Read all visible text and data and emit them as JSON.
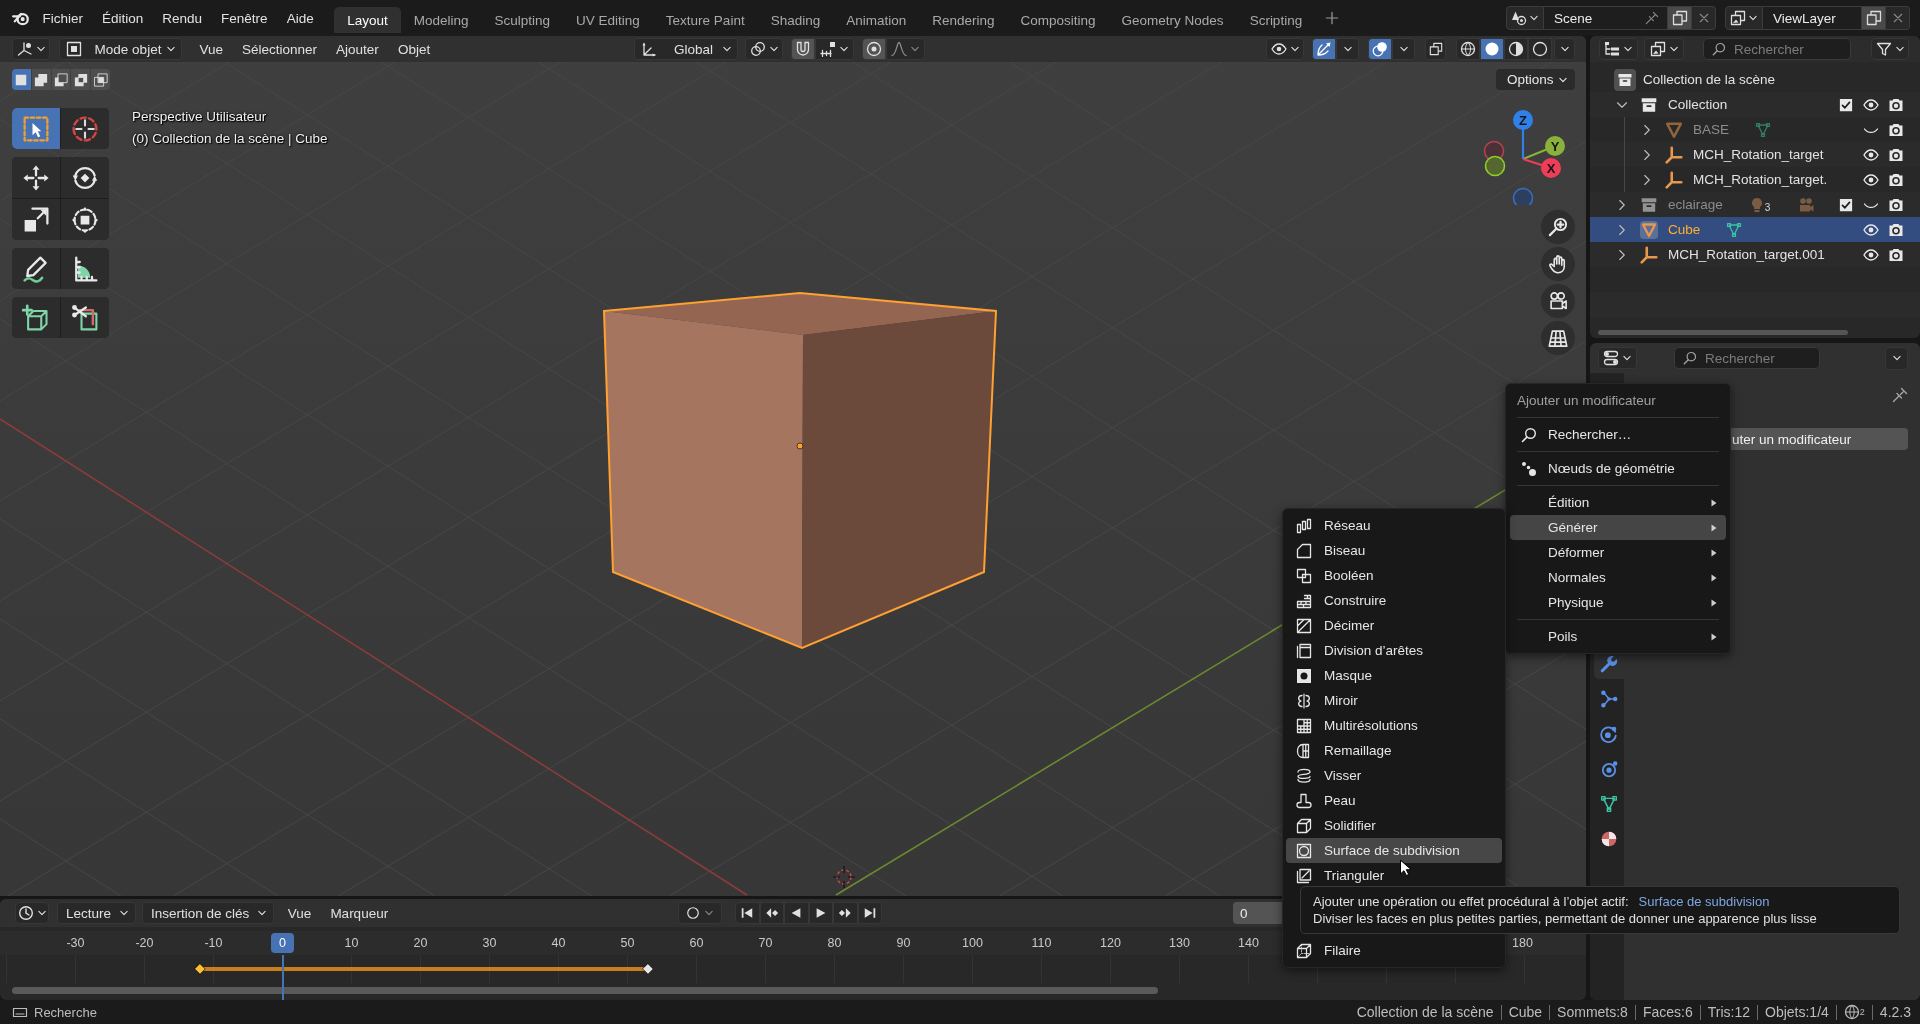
{
  "topbar": {
    "menus": [
      "Fichier",
      "Édition",
      "Rendu",
      "Fenêtre",
      "Aide"
    ],
    "workspaces": [
      {
        "label": "Layout",
        "selected": true
      },
      {
        "label": "Modeling",
        "selected": false
      },
      {
        "label": "Sculpting",
        "selected": false
      },
      {
        "label": "UV Editing",
        "selected": false
      },
      {
        "label": "Texture Paint",
        "selected": false
      },
      {
        "label": "Shading",
        "selected": false
      },
      {
        "label": "Animation",
        "selected": false
      },
      {
        "label": "Rendering",
        "selected": false
      },
      {
        "label": "Compositing",
        "selected": false
      },
      {
        "label": "Geometry Nodes",
        "selected": false
      },
      {
        "label": "Scripting",
        "selected": false
      }
    ],
    "scene": "Scene",
    "view_layer": "ViewLayer"
  },
  "viewport": {
    "header": {
      "mode": "Mode objet",
      "menus": [
        "Vue",
        "Sélectionner",
        "Ajouter",
        "Objet"
      ],
      "orientation": "Global",
      "gizmos": {
        "on": true
      },
      "overlays": {
        "on": true
      },
      "xray": {
        "on": false
      },
      "shading": [
        {
          "kind": "wireframe",
          "selected": false
        },
        {
          "kind": "solid",
          "selected": true
        },
        {
          "kind": "material",
          "selected": false
        },
        {
          "kind": "rendered",
          "selected": false
        }
      ]
    },
    "select_modes": [
      {
        "kind": "set",
        "selected": true
      },
      {
        "kind": "extend",
        "selected": false
      },
      {
        "kind": "subtract",
        "selected": false
      },
      {
        "kind": "invert",
        "selected": false
      },
      {
        "kind": "intersect",
        "selected": false
      }
    ],
    "tools": [
      [
        {
          "kind": "select",
          "selected": true
        },
        {
          "kind": "cursor",
          "selected": false
        }
      ],
      [
        {
          "kind": "move",
          "selected": false
        },
        {
          "kind": "rotate",
          "selected": false
        },
        {
          "kind": "scale",
          "selected": false
        },
        {
          "kind": "transform",
          "selected": false
        }
      ],
      [
        {
          "kind": "annotate",
          "selected": false
        },
        {
          "kind": "measure",
          "selected": false
        }
      ],
      [
        {
          "kind": "addcube",
          "selected": false
        },
        {
          "kind": "cut",
          "selected": false
        }
      ]
    ],
    "view_name": "Perspective Utilisateur",
    "context": "(0) Collection de la scène | Cube",
    "options": "Options",
    "axes": [
      "X",
      "Y",
      "Z"
    ]
  },
  "outliner": {
    "search_placeholder": "Rechercher",
    "tree": [
      {
        "name": "Collection de la scène",
        "kind": "scene_collection",
        "selected": false,
        "children": [
          {
            "name": "Collection",
            "kind": "collection",
            "expanded": true,
            "checked": true,
            "visible": true,
            "selected": false,
            "children": [
              {
                "name": "BASE",
                "kind": "mesh",
                "expanded": false,
                "visible": false,
                "selected": false,
                "data": [
                  {
                    "kind": "mesh"
                  }
                ]
              },
              {
                "name": "MCH_Rotation_target",
                "kind": "empty",
                "expanded": false,
                "visible": true,
                "selected": false
              },
              {
                "name": "MCH_Rotation_target.",
                "kind": "empty",
                "expanded": false,
                "visible": true,
                "selected": false
              }
            ]
          },
          {
            "name": "eclairage",
            "kind": "collection",
            "expanded": false,
            "checked": true,
            "visible": false,
            "selected": false,
            "data": [
              {
                "kind": "light",
                "count": "3"
              },
              {
                "kind": "camera"
              }
            ]
          },
          {
            "name": "Cube",
            "kind": "mesh",
            "expanded": false,
            "visible": true,
            "selected": true,
            "data": [
              {
                "kind": "mesh"
              }
            ]
          },
          {
            "name": "MCH_Rotation_target.001",
            "kind": "empty",
            "expanded": false,
            "visible": true,
            "selected": false
          }
        ]
      }
    ]
  },
  "properties": {
    "search_placeholder": "Rechercher",
    "tabs": [
      {
        "kind": "modifiers",
        "selected": true
      },
      {
        "kind": "particles",
        "selected": false
      },
      {
        "kind": "physics",
        "selected": false
      },
      {
        "kind": "constraints",
        "selected": false
      },
      {
        "kind": "data",
        "selected": false
      },
      {
        "kind": "material",
        "selected": false
      }
    ],
    "add_modifier_button": "uter un modificateur"
  },
  "timeline": {
    "menus": [
      {
        "label": "Lecture",
        "kind": "dropdown"
      },
      {
        "label": "Insertion de clés",
        "kind": "dropdown"
      },
      {
        "label": "Vue",
        "kind": "menu"
      },
      {
        "label": "Marqueur",
        "kind": "menu"
      }
    ],
    "current_frame": "0",
    "ruler": [
      {
        "label": "-30",
        "selected": false
      },
      {
        "label": "-20",
        "selected": false
      },
      {
        "label": "-10",
        "selected": false
      },
      {
        "label": "0",
        "selected": true
      },
      {
        "label": "10",
        "selected": false
      },
      {
        "label": "20",
        "selected": false
      },
      {
        "label": "30",
        "selected": false
      },
      {
        "label": "40",
        "selected": false
      },
      {
        "label": "50",
        "selected": false
      },
      {
        "label": "60",
        "selected": false
      },
      {
        "label": "70",
        "selected": false
      },
      {
        "label": "80",
        "selected": false
      },
      {
        "label": "90",
        "selected": false
      },
      {
        "label": "100",
        "selected": false
      },
      {
        "label": "110",
        "selected": false
      },
      {
        "label": "120",
        "selected": false
      },
      {
        "label": "130",
        "selected": false
      },
      {
        "label": "140",
        "selected": false
      }
    ],
    "ruler_end": [
      "180"
    ],
    "keyframes": [
      {
        "selected": true
      },
      {
        "selected": false
      }
    ]
  },
  "add_modifier_menu": {
    "title": "Ajouter un modificateur",
    "groups": [
      [
        {
          "kind": "search",
          "label": "Rechercher…",
          "selected": false
        }
      ],
      [
        {
          "kind": "nodes",
          "label": "Nœuds de géométrie",
          "selected": false
        }
      ],
      [
        {
          "kind": "submenu",
          "label": "Édition",
          "selected": false
        },
        {
          "kind": "submenu",
          "label": "Générer",
          "selected": true
        },
        {
          "kind": "submenu",
          "label": "Déformer",
          "selected": false
        },
        {
          "kind": "submenu",
          "label": "Normales",
          "selected": false
        },
        {
          "kind": "submenu",
          "label": "Physique",
          "selected": false
        }
      ],
      [
        {
          "kind": "submenu",
          "label": "Poils",
          "selected": false
        }
      ]
    ]
  },
  "generate_submenu": {
    "items": [
      {
        "kind": "array",
        "label": "Réseau",
        "selected": false
      },
      {
        "kind": "bevel",
        "label": "Biseau",
        "selected": false
      },
      {
        "kind": "boolean",
        "label": "Booléen",
        "selected": false
      },
      {
        "kind": "build",
        "label": "Construire",
        "selected": false
      },
      {
        "kind": "decimate",
        "label": "Décimer",
        "selected": false
      },
      {
        "kind": "edgesplit",
        "label": "Division d’arêtes",
        "selected": false
      },
      {
        "kind": "mask",
        "label": "Masque",
        "selected": false
      },
      {
        "kind": "mirror",
        "label": "Miroir",
        "selected": false
      },
      {
        "kind": "multires",
        "label": "Multirésolutions",
        "selected": false
      },
      {
        "kind": "remesh",
        "label": "Remaillage",
        "selected": false
      },
      {
        "kind": "screw",
        "label": "Visser",
        "selected": false
      },
      {
        "kind": "skin",
        "label": "Peau",
        "selected": false
      },
      {
        "kind": "solidify",
        "label": "Solidifier",
        "selected": false
      },
      {
        "kind": "subsurf",
        "label": "Surface de subdivision",
        "selected": true
      },
      {
        "kind": "triangulate",
        "label": "Trianguler",
        "selected": false
      }
    ],
    "items_after": [
      {
        "kind": "wireframe",
        "label": "Filaire",
        "selected": false
      }
    ]
  },
  "tooltip": {
    "text": "Ajouter une opération ou effet procédural à l’objet actif:",
    "operator": "Surface de subdivision",
    "detail": "Diviser les faces en plus petites parties, permettant de donner une apparence plus lisse"
  },
  "status_bar": {
    "hint": "Recherche",
    "stats": [
      "Collection de la scène",
      "Cube",
      "Sommets:8",
      "Faces:6",
      "Tris:12",
      "Objets:1/4"
    ],
    "notifications": "2",
    "version": "4.2.3"
  }
}
